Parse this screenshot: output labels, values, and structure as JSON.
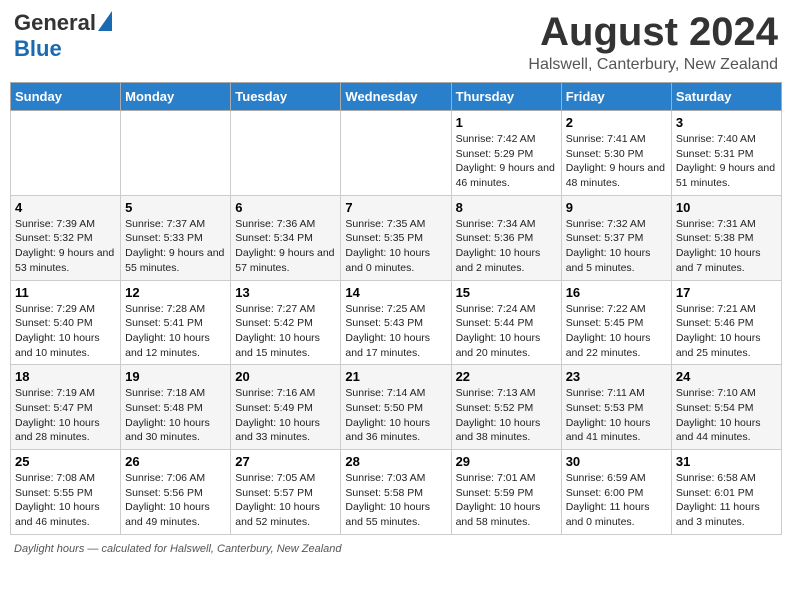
{
  "header": {
    "logo_general": "General",
    "logo_blue": "Blue",
    "month_title": "August 2024",
    "location": "Halswell, Canterbury, New Zealand"
  },
  "weekdays": [
    "Sunday",
    "Monday",
    "Tuesday",
    "Wednesday",
    "Thursday",
    "Friday",
    "Saturday"
  ],
  "weeks": [
    [
      {
        "day": "",
        "info": ""
      },
      {
        "day": "",
        "info": ""
      },
      {
        "day": "",
        "info": ""
      },
      {
        "day": "",
        "info": ""
      },
      {
        "day": "1",
        "info": "Sunrise: 7:42 AM\nSunset: 5:29 PM\nDaylight: 9 hours and 46 minutes."
      },
      {
        "day": "2",
        "info": "Sunrise: 7:41 AM\nSunset: 5:30 PM\nDaylight: 9 hours and 48 minutes."
      },
      {
        "day": "3",
        "info": "Sunrise: 7:40 AM\nSunset: 5:31 PM\nDaylight: 9 hours and 51 minutes."
      }
    ],
    [
      {
        "day": "4",
        "info": "Sunrise: 7:39 AM\nSunset: 5:32 PM\nDaylight: 9 hours and 53 minutes."
      },
      {
        "day": "5",
        "info": "Sunrise: 7:37 AM\nSunset: 5:33 PM\nDaylight: 9 hours and 55 minutes."
      },
      {
        "day": "6",
        "info": "Sunrise: 7:36 AM\nSunset: 5:34 PM\nDaylight: 9 hours and 57 minutes."
      },
      {
        "day": "7",
        "info": "Sunrise: 7:35 AM\nSunset: 5:35 PM\nDaylight: 10 hours and 0 minutes."
      },
      {
        "day": "8",
        "info": "Sunrise: 7:34 AM\nSunset: 5:36 PM\nDaylight: 10 hours and 2 minutes."
      },
      {
        "day": "9",
        "info": "Sunrise: 7:32 AM\nSunset: 5:37 PM\nDaylight: 10 hours and 5 minutes."
      },
      {
        "day": "10",
        "info": "Sunrise: 7:31 AM\nSunset: 5:38 PM\nDaylight: 10 hours and 7 minutes."
      }
    ],
    [
      {
        "day": "11",
        "info": "Sunrise: 7:29 AM\nSunset: 5:40 PM\nDaylight: 10 hours and 10 minutes."
      },
      {
        "day": "12",
        "info": "Sunrise: 7:28 AM\nSunset: 5:41 PM\nDaylight: 10 hours and 12 minutes."
      },
      {
        "day": "13",
        "info": "Sunrise: 7:27 AM\nSunset: 5:42 PM\nDaylight: 10 hours and 15 minutes."
      },
      {
        "day": "14",
        "info": "Sunrise: 7:25 AM\nSunset: 5:43 PM\nDaylight: 10 hours and 17 minutes."
      },
      {
        "day": "15",
        "info": "Sunrise: 7:24 AM\nSunset: 5:44 PM\nDaylight: 10 hours and 20 minutes."
      },
      {
        "day": "16",
        "info": "Sunrise: 7:22 AM\nSunset: 5:45 PM\nDaylight: 10 hours and 22 minutes."
      },
      {
        "day": "17",
        "info": "Sunrise: 7:21 AM\nSunset: 5:46 PM\nDaylight: 10 hours and 25 minutes."
      }
    ],
    [
      {
        "day": "18",
        "info": "Sunrise: 7:19 AM\nSunset: 5:47 PM\nDaylight: 10 hours and 28 minutes."
      },
      {
        "day": "19",
        "info": "Sunrise: 7:18 AM\nSunset: 5:48 PM\nDaylight: 10 hours and 30 minutes."
      },
      {
        "day": "20",
        "info": "Sunrise: 7:16 AM\nSunset: 5:49 PM\nDaylight: 10 hours and 33 minutes."
      },
      {
        "day": "21",
        "info": "Sunrise: 7:14 AM\nSunset: 5:50 PM\nDaylight: 10 hours and 36 minutes."
      },
      {
        "day": "22",
        "info": "Sunrise: 7:13 AM\nSunset: 5:52 PM\nDaylight: 10 hours and 38 minutes."
      },
      {
        "day": "23",
        "info": "Sunrise: 7:11 AM\nSunset: 5:53 PM\nDaylight: 10 hours and 41 minutes."
      },
      {
        "day": "24",
        "info": "Sunrise: 7:10 AM\nSunset: 5:54 PM\nDaylight: 10 hours and 44 minutes."
      }
    ],
    [
      {
        "day": "25",
        "info": "Sunrise: 7:08 AM\nSunset: 5:55 PM\nDaylight: 10 hours and 46 minutes."
      },
      {
        "day": "26",
        "info": "Sunrise: 7:06 AM\nSunset: 5:56 PM\nDaylight: 10 hours and 49 minutes."
      },
      {
        "day": "27",
        "info": "Sunrise: 7:05 AM\nSunset: 5:57 PM\nDaylight: 10 hours and 52 minutes."
      },
      {
        "day": "28",
        "info": "Sunrise: 7:03 AM\nSunset: 5:58 PM\nDaylight: 10 hours and 55 minutes."
      },
      {
        "day": "29",
        "info": "Sunrise: 7:01 AM\nSunset: 5:59 PM\nDaylight: 10 hours and 58 minutes."
      },
      {
        "day": "30",
        "info": "Sunrise: 6:59 AM\nSunset: 6:00 PM\nDaylight: 11 hours and 0 minutes."
      },
      {
        "day": "31",
        "info": "Sunrise: 6:58 AM\nSunset: 6:01 PM\nDaylight: 11 hours and 3 minutes."
      }
    ]
  ],
  "footer": {
    "label": "Daylight hours",
    "note": "calculated for Halswell, Canterbury, New Zealand"
  }
}
